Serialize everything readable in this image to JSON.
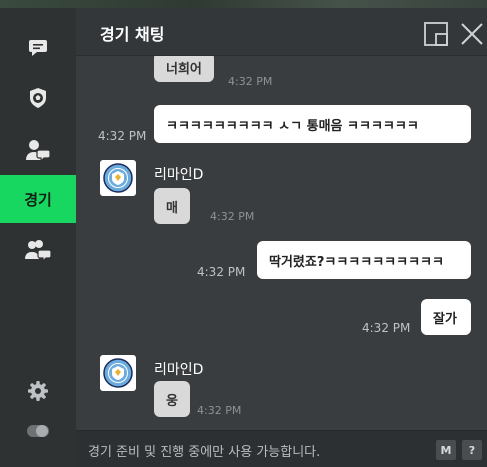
{
  "sidebar": {
    "items": [
      {
        "icon": "chat-bubble-icon"
      },
      {
        "icon": "soccer-ball-icon"
      },
      {
        "icon": "user-chat-icon"
      },
      {
        "label": "경기"
      },
      {
        "icon": "group-chat-icon"
      }
    ],
    "settings_icon": "gear-icon",
    "toggle_icon": "toggle-icon"
  },
  "header": {
    "title": "경기 채팅"
  },
  "messages": [
    {
      "text": "너희어",
      "time": "4:32 PM"
    },
    {
      "text": "ㅋㅋㅋㅋㅋㅋㅋㅋㅋ ㅅㄱ 통매음 ㅋㅋㅋㅋㅋㅋ",
      "time": "4:32 PM"
    },
    {
      "sender": "리마인D",
      "text": "매",
      "time": "4:32 PM"
    },
    {
      "text": "딱거렸죠?ㅋㅋㅋㅋㅋㅋㅋㅋㅋㅋ",
      "time": "4:32 PM"
    },
    {
      "text": "잘가",
      "time": "4:32 PM"
    },
    {
      "sender": "리마인D",
      "text": "웅",
      "time": "4:32 PM"
    }
  ],
  "footer": {
    "notice": "경기 준비 및 진행 중에만 사용 가능합니다.",
    "macro_key": "M",
    "help_key": "?"
  },
  "colors": {
    "accent": "#18d760",
    "panel": "#3a3d3f",
    "sidebar": "#2f3233"
  }
}
